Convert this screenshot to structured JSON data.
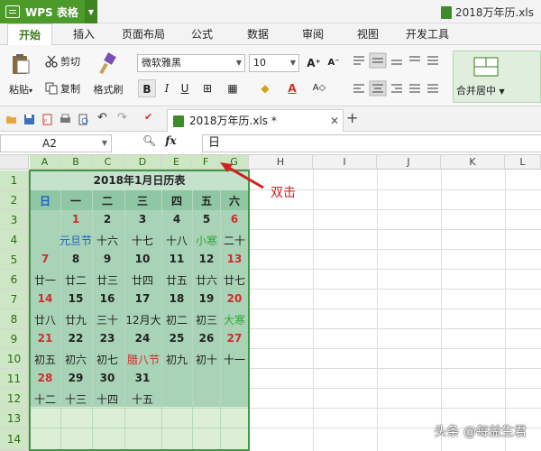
{
  "app": {
    "name": "WPS 表格",
    "doc_title": "2018万年历.xls"
  },
  "menu": {
    "tabs": [
      {
        "label": "开始"
      },
      {
        "label": "插入"
      },
      {
        "label": "页面布局"
      },
      {
        "label": "公式"
      },
      {
        "label": "数据"
      },
      {
        "label": "审阅"
      },
      {
        "label": "视图"
      },
      {
        "label": "开发工具"
      }
    ]
  },
  "ribbon": {
    "paste": "粘贴",
    "cut": "剪切",
    "copy": "复制",
    "format_painter": "格式刷",
    "font_name": "微软雅黑",
    "font_size": "10",
    "bold": "B",
    "italic": "I",
    "underline": "U",
    "merge_center": "合并居中"
  },
  "doc_tab": {
    "label": "2018万年历.xls *"
  },
  "formula_bar": {
    "cell_ref": "A2",
    "fx_label": "fx",
    "content": "日"
  },
  "sheet": {
    "columns": [
      "A",
      "B",
      "C",
      "D",
      "E",
      "F",
      "G",
      "H",
      "I",
      "J",
      "K",
      "L"
    ],
    "rows": [
      "1",
      "2",
      "3",
      "4",
      "5",
      "6",
      "7",
      "8",
      "9",
      "10",
      "11",
      "12",
      "13",
      "14"
    ],
    "calendar_title": "2018年1月日历表",
    "week_headers": [
      "日",
      "一",
      "二",
      "三",
      "四",
      "五",
      "六"
    ],
    "weeks": [
      [
        [
          "",
          ""
        ],
        [
          "1",
          ""
        ],
        [
          "2",
          ""
        ],
        [
          "3",
          ""
        ],
        [
          "4",
          ""
        ],
        [
          "5",
          ""
        ],
        [
          "6",
          ""
        ]
      ],
      [
        [
          "",
          ""
        ],
        [
          "元旦节",
          ""
        ],
        [
          "十六",
          ""
        ],
        [
          "十七",
          ""
        ],
        [
          "十八",
          ""
        ],
        [
          "小寒",
          ""
        ],
        [
          "二十",
          ""
        ]
      ],
      [
        [
          "7",
          ""
        ],
        [
          "8",
          ""
        ],
        [
          "9",
          ""
        ],
        [
          "10",
          ""
        ],
        [
          "11",
          ""
        ],
        [
          "12",
          ""
        ],
        [
          "13",
          ""
        ]
      ],
      [
        [
          "廿一",
          ""
        ],
        [
          "廿二",
          ""
        ],
        [
          "廿三",
          ""
        ],
        [
          "廿四",
          ""
        ],
        [
          "廿五",
          ""
        ],
        [
          "廿六",
          ""
        ],
        [
          "廿七",
          ""
        ]
      ],
      [
        [
          "14",
          ""
        ],
        [
          "15",
          ""
        ],
        [
          "16",
          ""
        ],
        [
          "17",
          ""
        ],
        [
          "18",
          ""
        ],
        [
          "19",
          ""
        ],
        [
          "20",
          ""
        ]
      ],
      [
        [
          "廿八",
          ""
        ],
        [
          "廿九",
          ""
        ],
        [
          "三十",
          ""
        ],
        [
          "12月大",
          ""
        ],
        [
          "初二",
          ""
        ],
        [
          "初三",
          ""
        ],
        [
          "大寒",
          ""
        ]
      ],
      [
        [
          "21",
          ""
        ],
        [
          "22",
          ""
        ],
        [
          "23",
          ""
        ],
        [
          "24",
          ""
        ],
        [
          "25",
          ""
        ],
        [
          "26",
          ""
        ],
        [
          "27",
          ""
        ]
      ],
      [
        [
          "初五",
          ""
        ],
        [
          "初六",
          ""
        ],
        [
          "初七",
          ""
        ],
        [
          "腊八节",
          ""
        ],
        [
          "初九",
          ""
        ],
        [
          "初十",
          ""
        ],
        [
          "十一",
          ""
        ]
      ],
      [
        [
          "28",
          ""
        ],
        [
          "29",
          ""
        ],
        [
          "30",
          ""
        ],
        [
          "31",
          ""
        ],
        [
          "",
          ""
        ],
        [
          "",
          ""
        ],
        [
          "",
          ""
        ]
      ],
      [
        [
          "十二",
          ""
        ],
        [
          "十三",
          ""
        ],
        [
          "十四",
          ""
        ],
        [
          "十五",
          ""
        ],
        [
          "",
          ""
        ],
        [
          "",
          ""
        ],
        [
          "",
          ""
        ]
      ]
    ]
  },
  "annotation": "双击",
  "watermark": "头条 @每益生君",
  "colors": {
    "accent": "#4c9a2a",
    "calendar_fill": "#a9d3b6",
    "red": "#d42a2a",
    "blue": "#1b5fc7",
    "green": "#2fa83a"
  }
}
